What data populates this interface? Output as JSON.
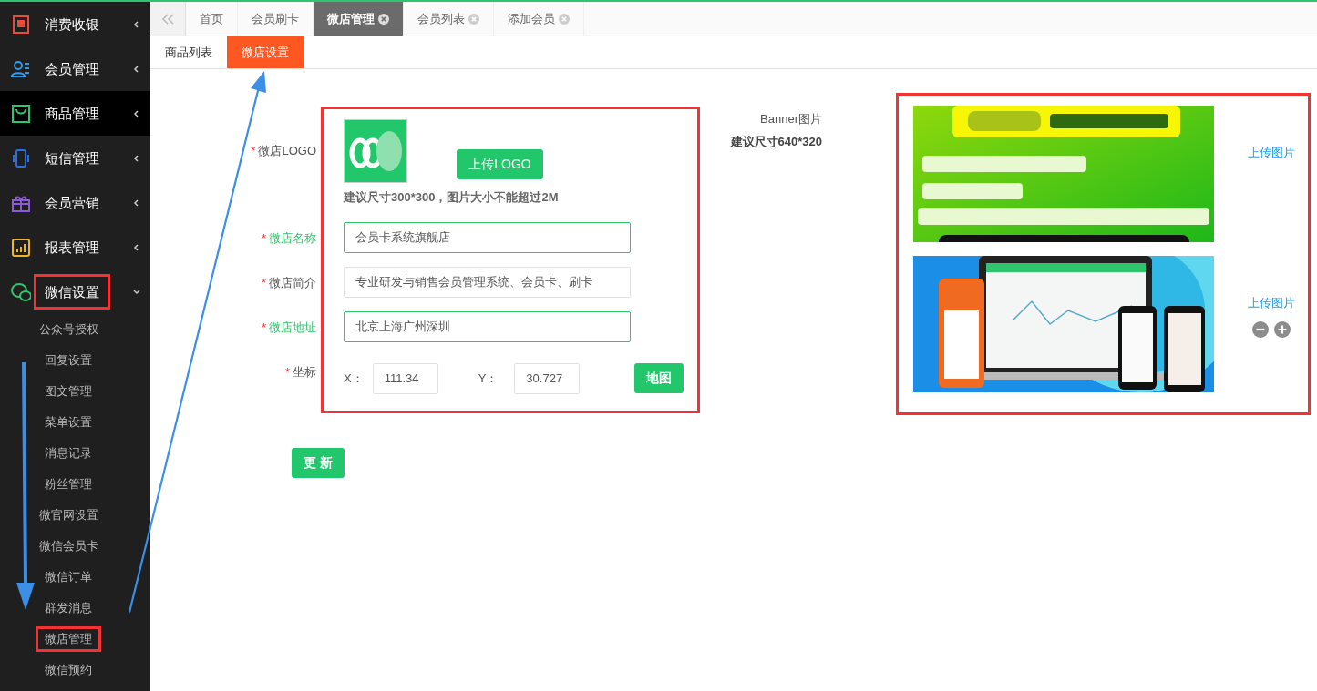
{
  "sidebar": {
    "menu": [
      {
        "label": "消费收银",
        "kind": "register",
        "selected": false,
        "expanded": false,
        "annotated": false
      },
      {
        "label": "会员管理",
        "kind": "member",
        "selected": false,
        "expanded": false,
        "annotated": false
      },
      {
        "label": "商品管理",
        "kind": "goods",
        "selected": true,
        "expanded": false,
        "annotated": false
      },
      {
        "label": "短信管理",
        "kind": "sms",
        "selected": false,
        "expanded": false,
        "annotated": false
      },
      {
        "label": "会员营销",
        "kind": "gift",
        "selected": false,
        "expanded": false,
        "annotated": false
      },
      {
        "label": "报表管理",
        "kind": "report",
        "selected": false,
        "expanded": false,
        "annotated": false
      },
      {
        "label": "微信设置",
        "kind": "wechat",
        "selected": false,
        "expanded": true,
        "annotated": true,
        "children": [
          {
            "label": "公众号授权",
            "annotated": false
          },
          {
            "label": "回复设置",
            "annotated": false
          },
          {
            "label": "图文管理",
            "annotated": false
          },
          {
            "label": "菜单设置",
            "annotated": false
          },
          {
            "label": "消息记录",
            "annotated": false
          },
          {
            "label": "粉丝管理",
            "annotated": false
          },
          {
            "label": "微官网设置",
            "annotated": false
          },
          {
            "label": "微信会员卡",
            "annotated": false
          },
          {
            "label": "微信订单",
            "annotated": false
          },
          {
            "label": "群发消息",
            "annotated": false
          },
          {
            "label": "微店管理",
            "annotated": true
          },
          {
            "label": "微信预约",
            "annotated": false
          }
        ]
      }
    ]
  },
  "tabs": [
    {
      "label": "首页",
      "selected": false,
      "closable": false
    },
    {
      "label": "会员刷卡",
      "selected": false,
      "closable": false
    },
    {
      "label": "微店管理",
      "selected": true,
      "closable": true
    },
    {
      "label": "会员列表",
      "selected": false,
      "closable": true
    },
    {
      "label": "添加会员",
      "selected": false,
      "closable": true
    }
  ],
  "subtabs": [
    {
      "label": "商品列表",
      "selected": false
    },
    {
      "label": "微店设置",
      "selected": true
    }
  ],
  "form": {
    "annotated": true,
    "fields": [
      {
        "kind": "logo",
        "mark": "*",
        "label": "微店LOGO",
        "highlighted": false,
        "button": "上传LOGO",
        "hint": "建议尺寸300*300，图片大小不能超过2M"
      },
      {
        "kind": "text",
        "mark": "*",
        "label": "微店名称",
        "highlighted": true,
        "value": "会员卡系统旗舰店"
      },
      {
        "kind": "text",
        "mark": "*",
        "label": "微店简介",
        "highlighted": false,
        "value": "专业研发与销售会员管理系统、会员卡、刷卡"
      },
      {
        "kind": "text",
        "mark": "*",
        "label": "微店地址",
        "highlighted": true,
        "value": "北京上海广州深圳"
      },
      {
        "kind": "coords",
        "mark": "*",
        "label": "坐标",
        "highlighted": false,
        "x_label": "X：",
        "x_value": "111.34",
        "y_label": "Y：",
        "y_value": "30.727",
        "button": "地图"
      }
    ],
    "submit": "更 新"
  },
  "banner": {
    "label": "Banner图片",
    "hint": "建议尺寸640*320",
    "annotated": true,
    "slides": [
      {
        "kind": "picture",
        "upload": "上传图片",
        "controls": false
      },
      {
        "kind": "picture",
        "upload": "上传图片",
        "controls": true
      }
    ]
  },
  "annotation_arrows": [
    {
      "kind": "arrow"
    },
    {
      "kind": "arrow"
    }
  ]
}
